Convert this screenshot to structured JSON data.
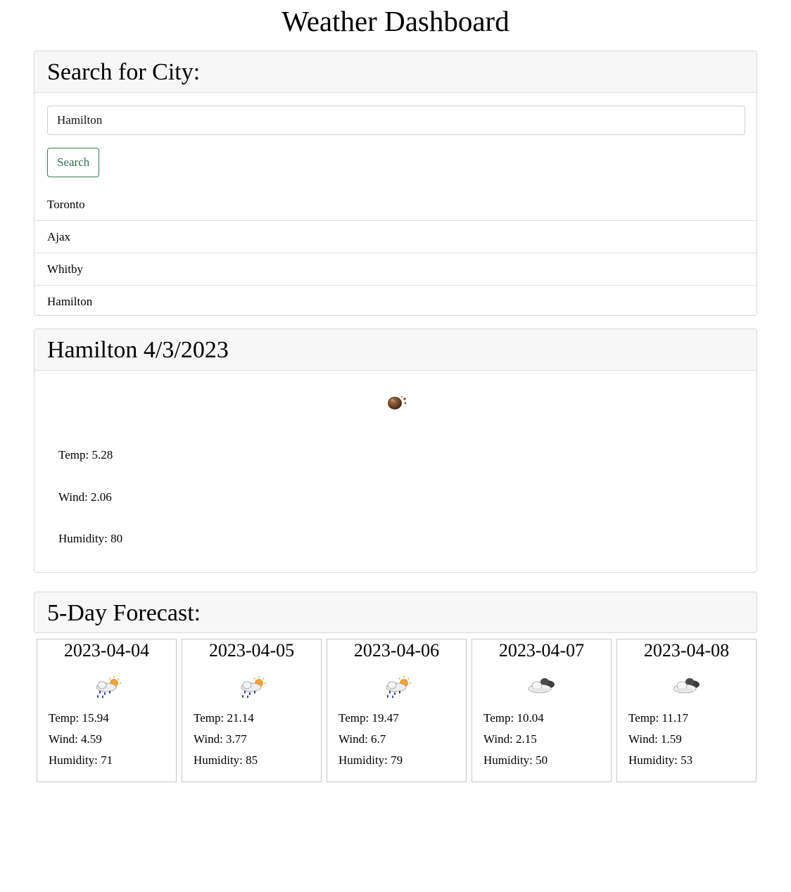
{
  "header": {
    "title": "Weather Dashboard"
  },
  "search": {
    "title": "Search for City:",
    "input_value": "Hamilton",
    "button_label": "Search",
    "history": [
      {
        "label": "Toronto"
      },
      {
        "label": "Ajax"
      },
      {
        "label": "Whitby"
      },
      {
        "label": "Hamilton"
      }
    ]
  },
  "current": {
    "title": "Hamilton 4/3/2023",
    "icon": "fog-icon",
    "temp": "Temp: 5.28",
    "wind": "Wind: 2.06",
    "humidity": "Humidity: 80"
  },
  "forecast": {
    "title": "5-Day Forecast:",
    "days": [
      {
        "date": "2023-04-04",
        "icon": "sun-rain-icon",
        "temp": "Temp: 15.94",
        "wind": "Wind: 4.59",
        "humidity": "Humidity: 71"
      },
      {
        "date": "2023-04-05",
        "icon": "sun-rain-icon",
        "temp": "Temp: 21.14",
        "wind": "Wind: 3.77",
        "humidity": "Humidity: 85"
      },
      {
        "date": "2023-04-06",
        "icon": "sun-rain-icon",
        "temp": "Temp: 19.47",
        "wind": "Wind: 6.7",
        "humidity": "Humidity: 79"
      },
      {
        "date": "2023-04-07",
        "icon": "cloudy-icon",
        "temp": "Temp: 10.04",
        "wind": "Wind: 2.15",
        "humidity": "Humidity: 50"
      },
      {
        "date": "2023-04-08",
        "icon": "cloudy-icon",
        "temp": "Temp: 11.17",
        "wind": "Wind: 1.59",
        "humidity": "Humidity: 53"
      }
    ]
  }
}
